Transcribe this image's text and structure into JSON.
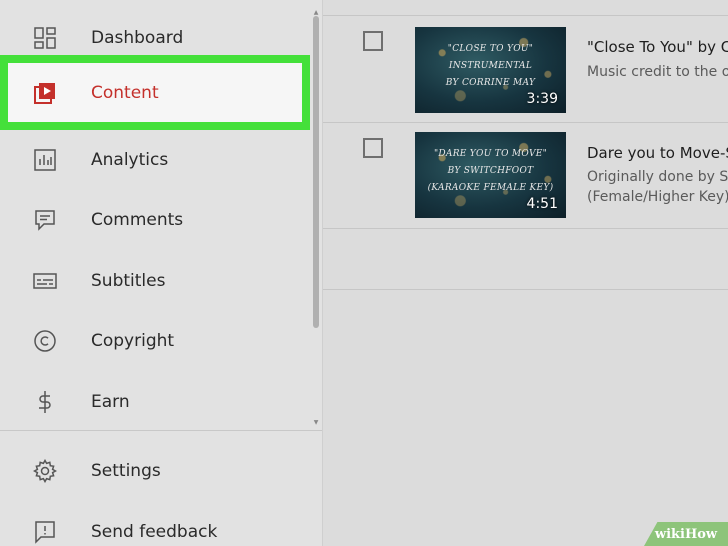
{
  "sidebar": {
    "items": [
      {
        "label": "Dashboard"
      },
      {
        "label": "Content"
      },
      {
        "label": "Analytics"
      },
      {
        "label": "Comments"
      },
      {
        "label": "Subtitles"
      },
      {
        "label": "Copyright"
      },
      {
        "label": "Earn"
      },
      {
        "label": "Settings"
      },
      {
        "label": "Send feedback"
      }
    ]
  },
  "videos": [
    {
      "thumb_lines": [
        "\"CLOSE TO YOU\"",
        "INSTRUMENTAL",
        "BY CORRINE MAY"
      ],
      "duration": "3:39",
      "title": "\"Close To You\" by C",
      "description": [
        "Music credit to the o"
      ]
    },
    {
      "thumb_lines": [
        "\"DARE YOU TO MOVE\"",
        "BY SWITCHFOOT",
        "(KARAOKE FEMALE KEY)"
      ],
      "duration": "4:51",
      "title": "Dare you to Move-S",
      "description": [
        "Originally done by Sw",
        "(Female/Higher Key)"
      ]
    }
  ],
  "watermark": "wikiHow",
  "colors": {
    "highlight": "#44e03a",
    "active_text": "#c4302b",
    "content_icon": "#c4302b"
  }
}
